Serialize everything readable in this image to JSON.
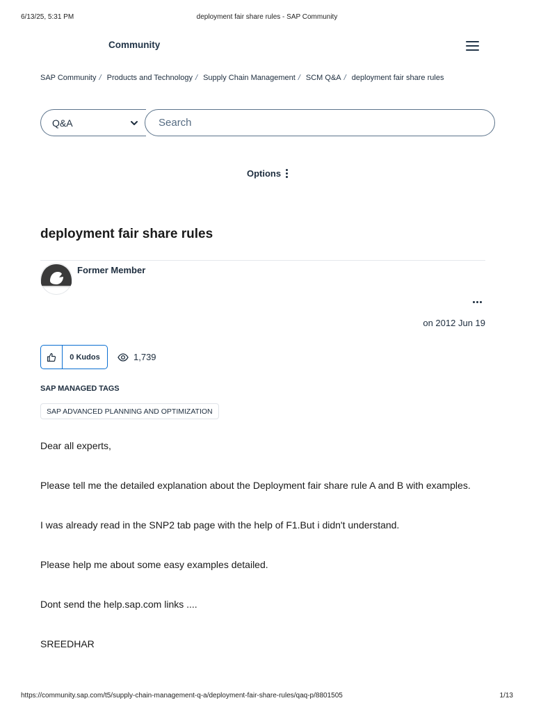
{
  "print_header": {
    "datetime": "6/13/25, 5:31 PM",
    "title": "deployment fair share rules - SAP Community"
  },
  "print_footer": {
    "url": "https://community.sap.com/t5/supply-chain-management-q-a/deployment-fair-share-rules/qaq-p/8801505",
    "page": "1/13"
  },
  "header": {
    "brand": "Community",
    "menu_icon": "hamburger-icon"
  },
  "breadcrumb": [
    "SAP Community",
    "Products and Technology",
    "Supply Chain Management",
    "SCM Q&A",
    "deployment fair share rules"
  ],
  "search": {
    "scope_value": "Q&A",
    "placeholder": "Search"
  },
  "options_label": "Options",
  "post": {
    "title": "deployment fair share rules",
    "author": "Former Member",
    "date": "on 2012 Jun 19",
    "kudos_label": "0 Kudos",
    "views": "1,739",
    "tags_label": "SAP MANAGED TAGS",
    "tags": [
      "SAP ADVANCED PLANNING AND OPTIMIZATION"
    ],
    "body": [
      "Dear all experts,",
      "Please tell me the detailed explanation about the Deployment  fair share rule A and B with examples.",
      "I was already read in the SNP2 tab page with the help of F1.But i didn't understand.",
      "Please help me about some easy examples detailed.",
      "Dont send the help.sap.com links ....",
      "SREEDHAR"
    ]
  },
  "colors": {
    "accent": "#0a6ed1",
    "text": "#1d2d3e",
    "border": "#5b738b"
  }
}
